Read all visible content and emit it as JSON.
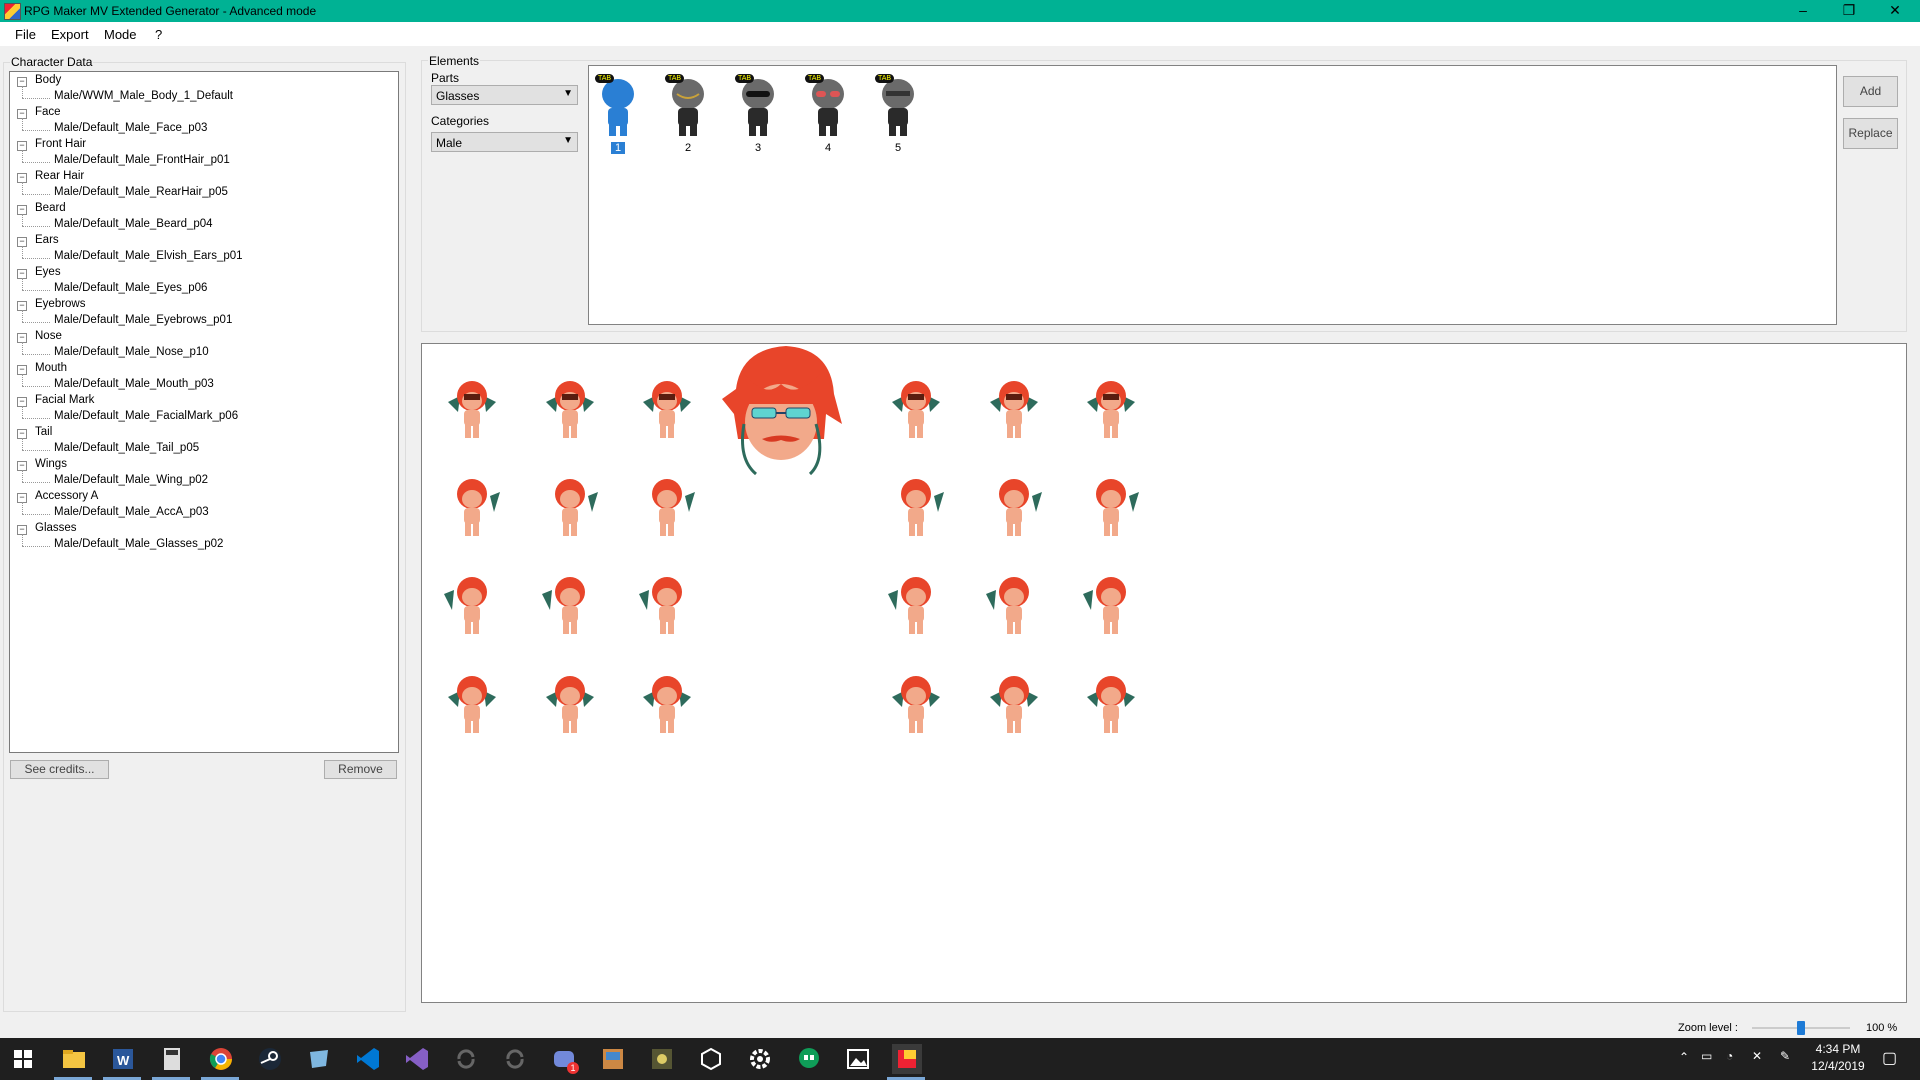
{
  "window": {
    "title": "RPG Maker MV Extended Generator - Advanced mode",
    "controls": [
      "–",
      "❐",
      "✕"
    ]
  },
  "menu": [
    "File",
    "Export",
    "Mode",
    "?"
  ],
  "character_data": {
    "legend": "Character Data",
    "tree": [
      {
        "label": "Body",
        "child": "Male/WWM_Male_Body_1_Default"
      },
      {
        "label": "Face",
        "child": "Male/Default_Male_Face_p03"
      },
      {
        "label": "Front Hair",
        "child": "Male/Default_Male_FrontHair_p01"
      },
      {
        "label": "Rear Hair",
        "child": "Male/Default_Male_RearHair_p05"
      },
      {
        "label": "Beard",
        "child": "Male/Default_Male_Beard_p04"
      },
      {
        "label": "Ears",
        "child": "Male/Default_Male_Elvish_Ears_p01"
      },
      {
        "label": "Eyes",
        "child": "Male/Default_Male_Eyes_p06"
      },
      {
        "label": "Eyebrows",
        "child": "Male/Default_Male_Eyebrows_p01"
      },
      {
        "label": "Nose",
        "child": "Male/Default_Male_Nose_p10"
      },
      {
        "label": "Mouth",
        "child": "Male/Default_Male_Mouth_p03"
      },
      {
        "label": "Facial Mark",
        "child": "Male/Default_Male_FacialMark_p06"
      },
      {
        "label": "Tail",
        "child": "Male/Default_Male_Tail_p05"
      },
      {
        "label": "Wings",
        "child": "Male/Default_Male_Wing_p02"
      },
      {
        "label": "Accessory A",
        "child": "Male/Default_Male_AccA_p03"
      },
      {
        "label": "Glasses",
        "child": "Male/Default_Male_Glasses_p02"
      }
    ],
    "see_credits_label": "See credits...",
    "remove_label": "Remove"
  },
  "elements": {
    "legend": "Elements",
    "parts_label": "Parts",
    "parts_value": "Glasses",
    "categories_label": "Categories",
    "categories_value": "Male",
    "items": [
      {
        "num": "1",
        "badge": "TAB",
        "selected": true
      },
      {
        "num": "2",
        "badge": "TAB",
        "selected": false
      },
      {
        "num": "3",
        "badge": "TAB",
        "selected": false
      },
      {
        "num": "4",
        "badge": "TAB",
        "selected": false
      },
      {
        "num": "5",
        "badge": "TAB",
        "selected": false
      }
    ],
    "add_label": "Add",
    "replace_label": "Replace"
  },
  "status": {
    "zoom_label": "Zoom level :",
    "zoom_value": "100 %",
    "zoom_fraction": 0.5
  },
  "taskbar": {
    "time": "4:34 PM",
    "date": "12/4/2019",
    "notification_count": "1"
  },
  "colors": {
    "titlebar": "#00b294",
    "hair": "#e8452a",
    "wing": "#2e6b5c",
    "skin": "#f2a98a",
    "selected": "#2a7fd4"
  }
}
